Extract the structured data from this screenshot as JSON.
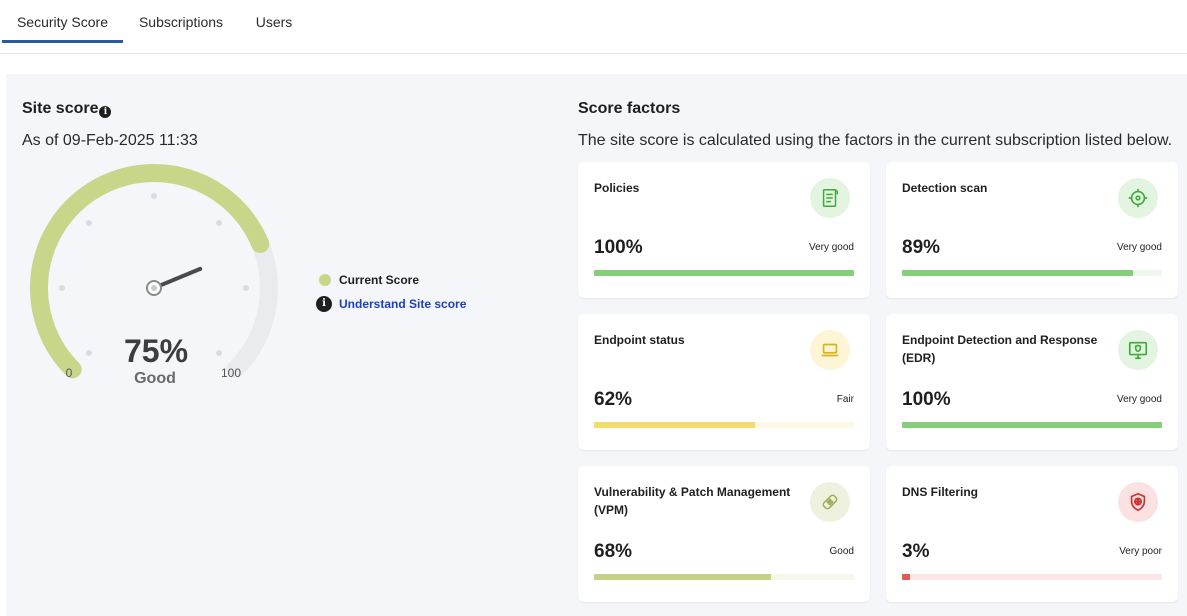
{
  "tabs": [
    {
      "label": "Security Score",
      "active": true
    },
    {
      "label": "Subscriptions",
      "active": false
    },
    {
      "label": "Users",
      "active": false
    }
  ],
  "site": {
    "title": "Site score",
    "info_icon": "info-icon",
    "as_of": "As of 09-Feb-2025 11:33",
    "score_value": "75%",
    "score_label": "Good",
    "score_fraction": 0.75,
    "min_label": "0",
    "max_label": "100",
    "colors": {
      "arc": "#c8d68a",
      "track": "#e9ecef",
      "needle": "#4a4a4a"
    }
  },
  "legend": {
    "current": "Current Score",
    "link": "Understand Site score"
  },
  "factors": {
    "title": "Score factors",
    "description": "The site score is calculated using the factors in the current subscription listed below.",
    "cards": [
      {
        "title": "Policies",
        "value": "100%",
        "rating": "Very good",
        "fraction": 1.0,
        "icon": "policy-document-icon",
        "fill": "#86cf7a",
        "track": "#eef8ec",
        "icon_bg": "#e3f4e0",
        "icon_color": "#3eaa3a"
      },
      {
        "title": "Detection scan",
        "value": "89%",
        "rating": "Very good",
        "fraction": 0.89,
        "icon": "crosshair-icon",
        "fill": "#86cf7a",
        "track": "#eef8ec",
        "icon_bg": "#e3f4e0",
        "icon_color": "#3eaa3a"
      },
      {
        "title": "Endpoint status",
        "value": "62%",
        "rating": "Fair",
        "fraction": 0.62,
        "icon": "laptop-icon",
        "fill": "#f4dc6a",
        "track": "#fdf8e4",
        "icon_bg": "#fdf5d6",
        "icon_color": "#d9b21f"
      },
      {
        "title": "Endpoint Detection and Response (EDR)",
        "value": "100%",
        "rating": "Very good",
        "fraction": 1.0,
        "icon": "monitor-shield-icon",
        "fill": "#86cf7a",
        "track": "#eef8ec",
        "icon_bg": "#e3f4e0",
        "icon_color": "#3eaa3a"
      },
      {
        "title": "Vulnerability & Patch Management (VPM)",
        "value": "68%",
        "rating": "Good",
        "fraction": 0.68,
        "icon": "patch-icon",
        "fill": "#c4d187",
        "track": "#f6f8ea",
        "icon_bg": "#eef1de",
        "icon_color": "#9bab55"
      },
      {
        "title": "DNS Filtering",
        "value": "3%",
        "rating": "Very poor",
        "fraction": 0.03,
        "icon": "shield-web-icon",
        "fill": "#e05a5a",
        "track": "#fbe6e6",
        "icon_bg": "#fbe1e1",
        "icon_color": "#d0302f"
      }
    ]
  }
}
